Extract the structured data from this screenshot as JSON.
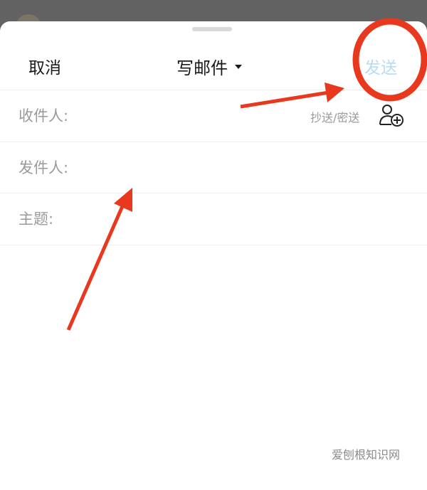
{
  "header": {
    "cancel_label": "取消",
    "title": "写邮件",
    "send_label": "发送"
  },
  "fields": {
    "to_label": "收件人:",
    "cc_bcc_label": "抄送/密送",
    "from_label": "发件人:",
    "subject_label": "主题:"
  },
  "watermark": "爱刨根知识网",
  "icons": {
    "title_dropdown": "caret-down-icon",
    "add_contact": "add-contact-icon"
  },
  "colors": {
    "send_disabled": "#b8dcf5",
    "annotation_red": "#e8391f",
    "label_gray": "#9a9a9a"
  }
}
